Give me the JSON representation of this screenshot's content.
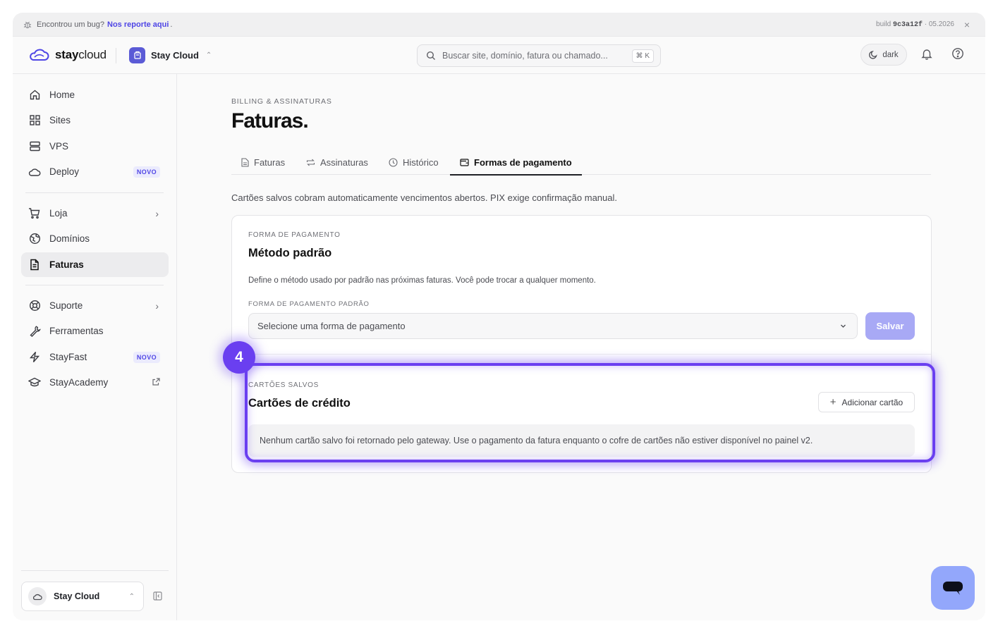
{
  "notice": {
    "message": "Encontrou um bug?",
    "link": "Nos reporte aqui",
    "dot": ".",
    "build_prefix": "build",
    "build_hash": "9c3a12f",
    "build_date": "· 05.2026"
  },
  "header": {
    "logo_bold": "stay",
    "logo_light": "cloud",
    "workspace": "Stay Cloud",
    "search_placeholder": "Buscar site, domínio, fatura ou chamado...",
    "search_shortcut": "⌘ K",
    "theme_label": "dark"
  },
  "sidebar": {
    "items": [
      {
        "label": "Home",
        "icon": "home-icon"
      },
      {
        "label": "Sites",
        "icon": "grid-icon"
      },
      {
        "label": "VPS",
        "icon": "server-icon"
      },
      {
        "label": "Deploy",
        "icon": "cloud-icon",
        "badge": "NOVO"
      },
      {
        "label": "Loja",
        "icon": "cart-icon"
      },
      {
        "label": "Domínios",
        "icon": "globe-icon"
      },
      {
        "label": "Faturas",
        "icon": "file-icon",
        "active": true
      },
      {
        "label": "Suporte",
        "icon": "lifebuoy-icon"
      },
      {
        "label": "Ferramentas",
        "icon": "wrench-icon"
      },
      {
        "label": "StayFast",
        "icon": "bolt-icon",
        "badge": "NOVO"
      },
      {
        "label": "StayAcademy",
        "icon": "graduation-cap-icon"
      }
    ],
    "account": "Stay Cloud"
  },
  "main": {
    "eyebrow": "BILLING & ASSINATURAS",
    "title": "Faturas.",
    "tabs": [
      {
        "label": "Faturas"
      },
      {
        "label": "Assinaturas"
      },
      {
        "label": "Histórico"
      },
      {
        "label": "Formas de pagamento",
        "active": true
      }
    ],
    "description": "Cartões salvos cobram automaticamente vencimentos abertos. PIX exige confirmação manual.",
    "payment": {
      "eyebrow": "FORMA DE PAGAMENTO",
      "title": "Método padrão",
      "description": "Define o método usado por padrão nas próximas faturas. Você pode trocar a qualquer momento.",
      "field_label": "FORMA DE PAGAMENTO PADRÃO",
      "select_value": "Selecione uma forma de pagamento",
      "save_label": "Salvar"
    },
    "cards": {
      "eyebrow": "CARTÕES SALVOS",
      "title": "Cartões de crédito",
      "add_label": "Adicionar cartão",
      "empty_message": "Nenhum cartão salvo foi retornado pelo gateway. Use o pagamento da fatura enquanto o cofre de cartões não estiver disponível no painel v2."
    }
  },
  "highlight": {
    "step": "4",
    "color": "#6a3ff0"
  },
  "colors": {
    "accent": "#5b5bd6",
    "save_button": "#a8a9f5",
    "chat_button": "#93a7fb",
    "badge_text": "#5046e5"
  }
}
